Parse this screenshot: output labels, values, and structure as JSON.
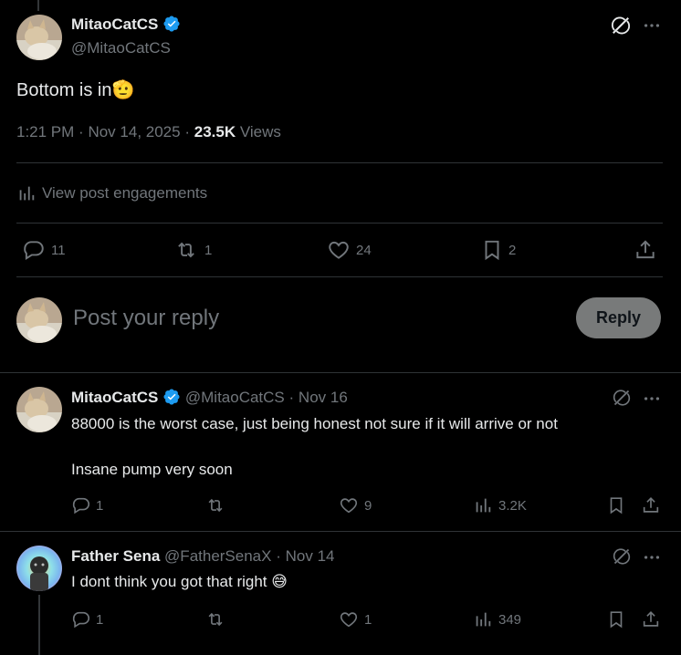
{
  "main_post": {
    "display_name": "MitaoCatCS",
    "handle": "@MitaoCatCS",
    "text": "Bottom is in",
    "text_emoji": "🫡",
    "time": "1:21 PM",
    "date": "Nov 14, 2025",
    "views_count": "23.5K",
    "views_label": "Views",
    "engagements_label": "View post engagements",
    "replies": "11",
    "reposts": "1",
    "likes": "24",
    "bookmarks": "2"
  },
  "composer": {
    "placeholder": "Post your reply",
    "reply_label": "Reply"
  },
  "replies": [
    {
      "display_name": "MitaoCatCS",
      "handle": "@MitaoCatCS",
      "date": "Nov 16",
      "text_line1": "88000 is the worst case, just being honest not sure if it will arrive or not",
      "text_line2": "Insane pump very soon",
      "replies": "1",
      "reposts": "",
      "likes": "9",
      "views": "3.2K"
    },
    {
      "display_name": "Father Sena",
      "handle": "@FatherSenaX",
      "date": "Nov 14",
      "text": "I dont think you got that right",
      "text_emoji": "😅",
      "replies": "1",
      "reposts": "",
      "likes": "1",
      "views": "349"
    }
  ],
  "separators": {
    "dot": "·"
  },
  "colors": {
    "background": "#000000",
    "text": "#e7e9ea",
    "muted": "#71767b",
    "divider": "#2f3336",
    "verified": "#1d9bf0",
    "reply_button": "#787a7a"
  },
  "icons": [
    "grok-icon",
    "more-icon",
    "verified-badge-icon",
    "analytics-icon",
    "reply-icon",
    "repost-icon",
    "like-icon",
    "bookmark-icon",
    "share-icon"
  ]
}
